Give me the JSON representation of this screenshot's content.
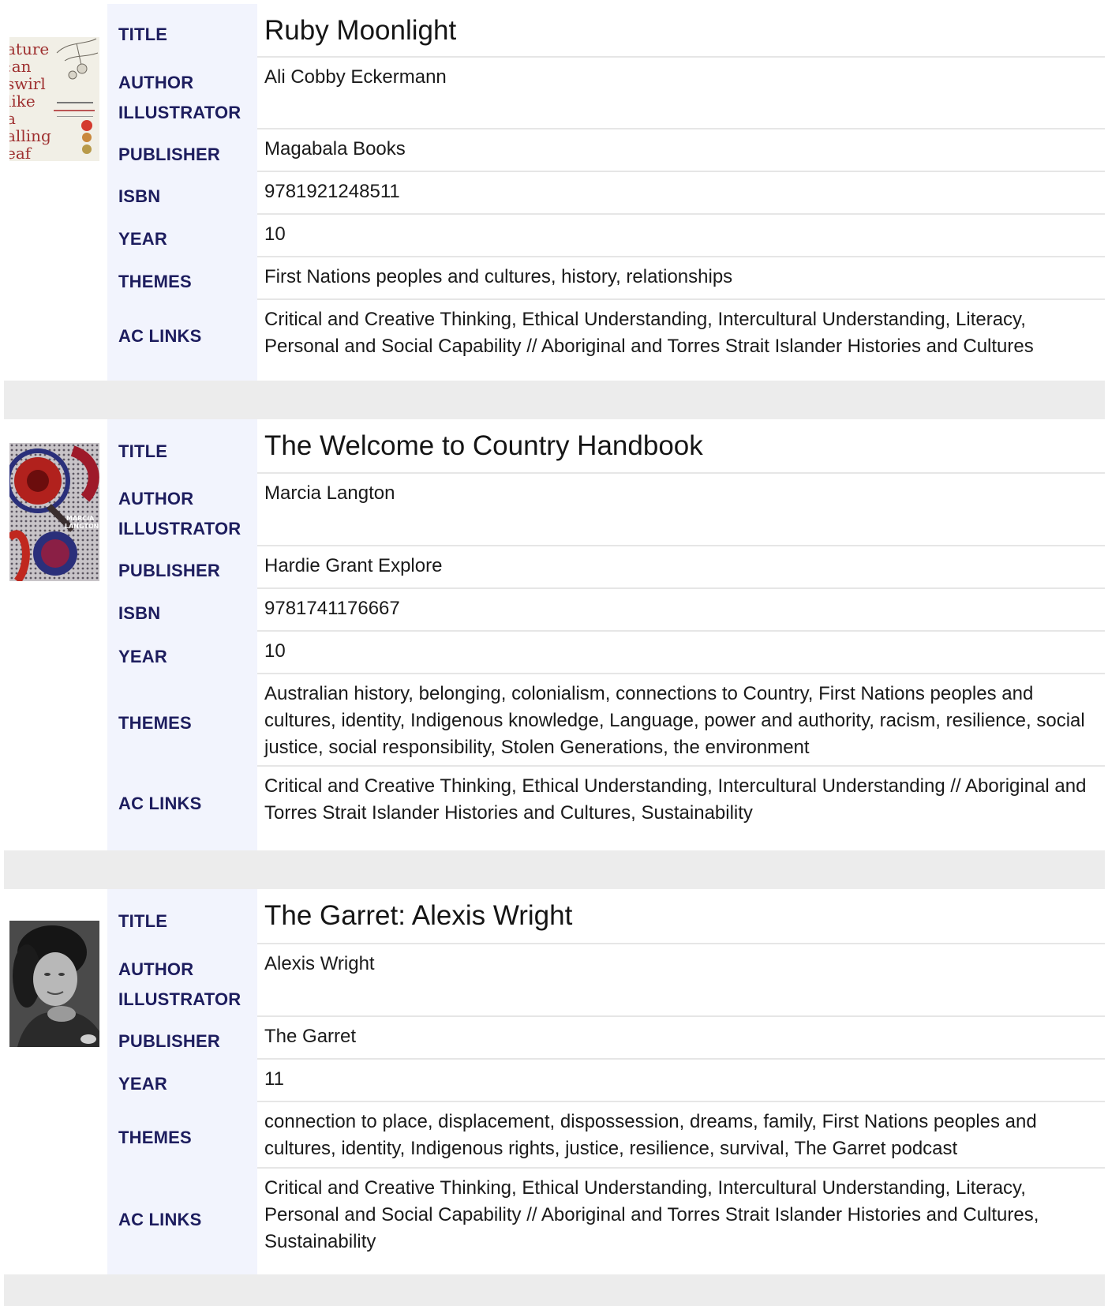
{
  "labels": {
    "title": "TITLE",
    "author": "AUTHOR",
    "illustrator": "ILLUSTRATOR",
    "publisher": "PUBLISHER",
    "isbn": "ISBN",
    "year": "YEAR",
    "themes": "THEMES",
    "ac_links": "AC LINKS"
  },
  "books": [
    {
      "cover_icon": "book-cover-image",
      "cover_text": "nature can swirl like a falling leaf",
      "title": "Ruby Moonlight",
      "author": "Ali Cobby Eckermann",
      "illustrator": "",
      "publisher": "Magabala Books",
      "isbn": "9781921248511",
      "year": "10",
      "themes": "First Nations peoples and cultures, history, relationships",
      "ac_links": "Critical and Creative Thinking, Ethical Understanding, Intercultural Understanding, Literacy, Personal and Social Capability // Aboriginal and Torres Strait Islander Histories and Cultures"
    },
    {
      "cover_icon": "book-cover-image",
      "title": "The Welcome to Country Handbook",
      "author": "Marcia Langton",
      "illustrator": "",
      "publisher": "Hardie Grant Explore",
      "isbn": "9781741176667",
      "year": "10",
      "themes": "Australian history, belonging, colonialism, connections to Country, First Nations peoples and cultures, identity, Indigenous knowledge, Language, power and authority, racism, resilience, social justice, social responsibility, Stolen Generations, the environment",
      "ac_links": "Critical and Creative Thinking, Ethical Understanding, Intercultural Understanding // Aboriginal and Torres Strait Islander Histories and Cultures, Sustainability"
    },
    {
      "cover_icon": "author-portrait-photo",
      "title": "The Garret: Alexis Wright",
      "author": "Alexis Wright",
      "illustrator": "",
      "publisher": "The Garret",
      "year": "11",
      "themes": "connection to place, displacement, dispossession, dreams, family, First Nations peoples and cultures, identity, Indigenous rights, justice, resilience, survival, The Garret podcast",
      "ac_links": "Critical and Creative Thinking, Ethical Understanding, Intercultural Understanding, Literacy, Personal and Social Capability // Aboriginal and Torres Strait Islander Histories and Cultures, Sustainability"
    }
  ]
}
